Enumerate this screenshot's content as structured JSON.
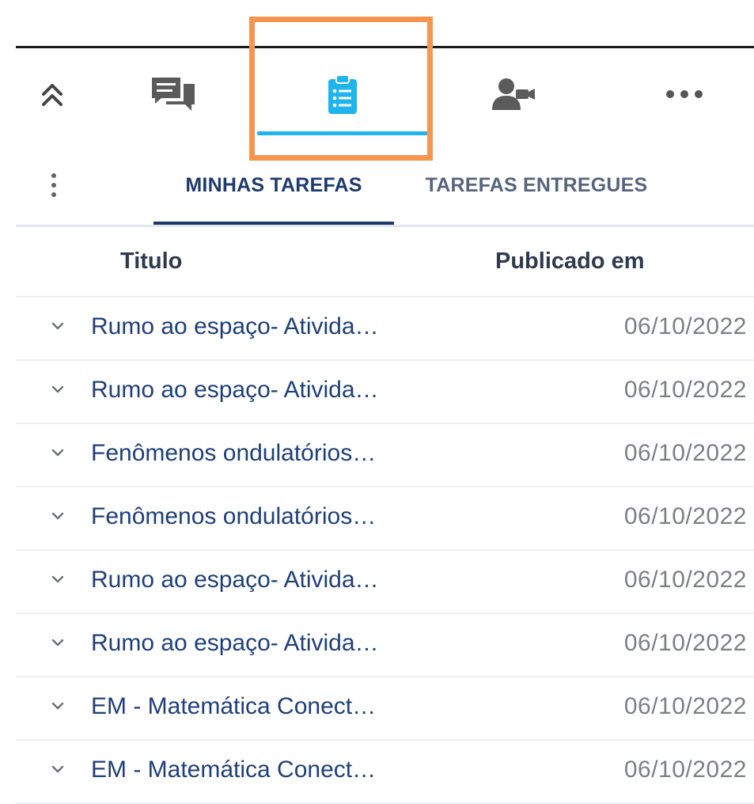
{
  "icon_bar": {
    "items": [
      {
        "icon": "double-chevron-up-icon"
      },
      {
        "icon": "chat-bubbles-icon"
      },
      {
        "icon": "clipboard-list-icon",
        "active": true
      },
      {
        "icon": "person-video-icon"
      },
      {
        "icon": "more-horizontal-icon"
      }
    ],
    "active_color": "#1fb4ee",
    "highlight_color": "#f7954f"
  },
  "subtabs": {
    "active_label": "MINHAS TAREFAS",
    "inactive_label": "TAREFAS ENTREGUES"
  },
  "table": {
    "headers": {
      "title": "Titulo",
      "published": "Publicado em"
    },
    "rows": [
      {
        "title": "Rumo ao espaço- Ativida…",
        "date": "06/10/2022"
      },
      {
        "title": "Rumo ao espaço- Ativida…",
        "date": "06/10/2022"
      },
      {
        "title": "Fenômenos ondulatórios…",
        "date": "06/10/2022"
      },
      {
        "title": "Fenômenos ondulatórios…",
        "date": "06/10/2022"
      },
      {
        "title": "Rumo ao espaço- Ativida…",
        "date": "06/10/2022"
      },
      {
        "title": "Rumo ao espaço- Ativida…",
        "date": "06/10/2022"
      },
      {
        "title": "EM - Matemática Conect…",
        "date": "06/10/2022"
      },
      {
        "title": "EM - Matemática Conect…",
        "date": "06/10/2022"
      }
    ]
  }
}
